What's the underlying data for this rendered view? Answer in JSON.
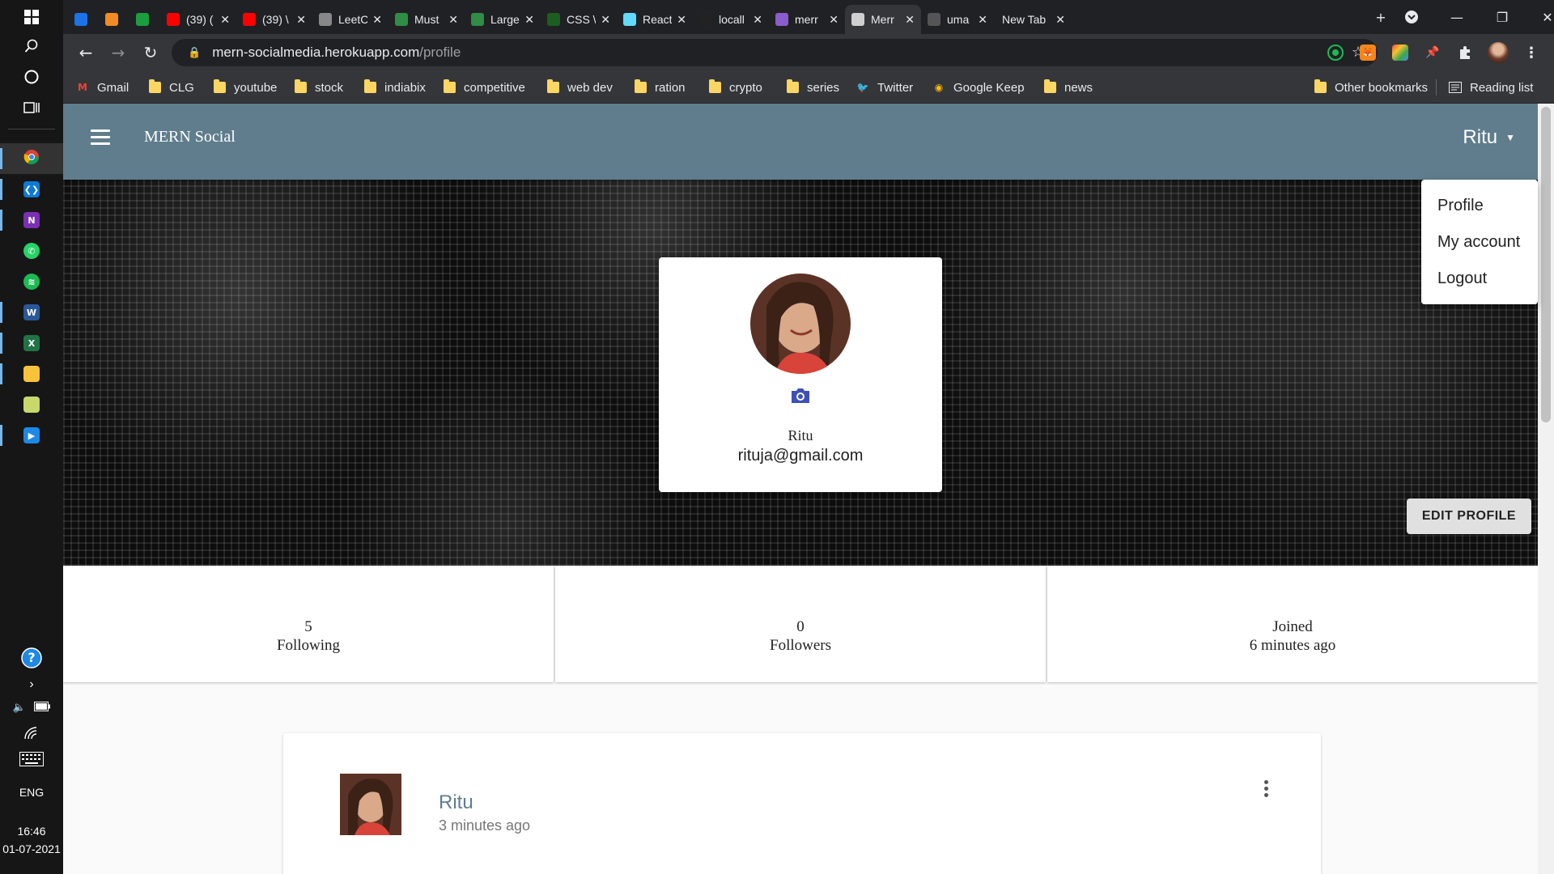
{
  "taskbar": {
    "apps": [
      {
        "name": "chrome",
        "color": "#e8453c"
      },
      {
        "name": "vscode",
        "color": "#0e7ad3"
      },
      {
        "name": "onenote",
        "color": "#7b2fb5"
      },
      {
        "name": "whatsapp",
        "color": "#25d366"
      },
      {
        "name": "spotify",
        "color": "#1db954"
      },
      {
        "name": "word",
        "color": "#2b579a"
      },
      {
        "name": "excel",
        "color": "#217346"
      },
      {
        "name": "file-explorer",
        "color": "#f8c33a"
      },
      {
        "name": "photos",
        "color": "#c8d86a"
      },
      {
        "name": "video",
        "color": "#1e88e5"
      }
    ],
    "language": "ENG",
    "time": "16:46",
    "date": "01-07-2021"
  },
  "browser": {
    "tabs": [
      {
        "title": "",
        "color": "#1a73e8"
      },
      {
        "title": "",
        "color": "#f28b22"
      },
      {
        "title": "",
        "color": "#1b9e3e"
      },
      {
        "title": "(39) (",
        "color": "#ff0000"
      },
      {
        "title": "(39) \\",
        "color": "#ff0000"
      },
      {
        "title": "LeetC",
        "color": "#888888"
      },
      {
        "title": "Must",
        "color": "#2f8d46"
      },
      {
        "title": "Large",
        "color": "#2f8d46"
      },
      {
        "title": "CSS \\",
        "color": "#1b5e20"
      },
      {
        "title": "React",
        "color": "#61dafb"
      },
      {
        "title": "locall",
        "color": "#222222"
      },
      {
        "title": "merr",
        "color": "#8c5ccd"
      },
      {
        "title": "Merr",
        "color": "#cfcfcf"
      },
      {
        "title": "uma",
        "color": "#555555"
      },
      {
        "title": "New Tab",
        "color": ""
      }
    ],
    "url_host": "mern-socialmedia.herokuapp.com",
    "url_path": "/profile",
    "bookmarks": [
      {
        "label": "Gmail",
        "icon": "gmail"
      },
      {
        "label": "CLG",
        "icon": "folder"
      },
      {
        "label": "youtube",
        "icon": "folder"
      },
      {
        "label": "stock",
        "icon": "folder"
      },
      {
        "label": "indiabix",
        "icon": "folder"
      },
      {
        "label": "competitive",
        "icon": "folder"
      },
      {
        "label": "web dev",
        "icon": "folder"
      },
      {
        "label": "ration",
        "icon": "folder"
      },
      {
        "label": "crypto",
        "icon": "folder"
      },
      {
        "label": "series",
        "icon": "folder"
      },
      {
        "label": "Twitter",
        "icon": "twitter"
      },
      {
        "label": "Google Keep",
        "icon": "keep"
      },
      {
        "label": "news",
        "icon": "folder"
      }
    ],
    "other_bookmarks": "Other bookmarks",
    "reading_list": "Reading list"
  },
  "app": {
    "brand": "MERN Social",
    "user": "Ritu",
    "menu": [
      "Profile",
      "My account",
      "Logout"
    ],
    "profile": {
      "name": "Ritu",
      "email": "rituja@gmail.com"
    },
    "edit_profile": "EDIT PROFILE",
    "stats": [
      {
        "value": "5",
        "label": "Following"
      },
      {
        "value": "0",
        "label": "Followers"
      },
      {
        "value": "Joined",
        "label": "6 minutes ago"
      }
    ],
    "post": {
      "author": "Ritu",
      "time": "3 minutes ago"
    },
    "colors": {
      "appbar": "#5f7d8c",
      "accent": "#3f51b5"
    }
  }
}
